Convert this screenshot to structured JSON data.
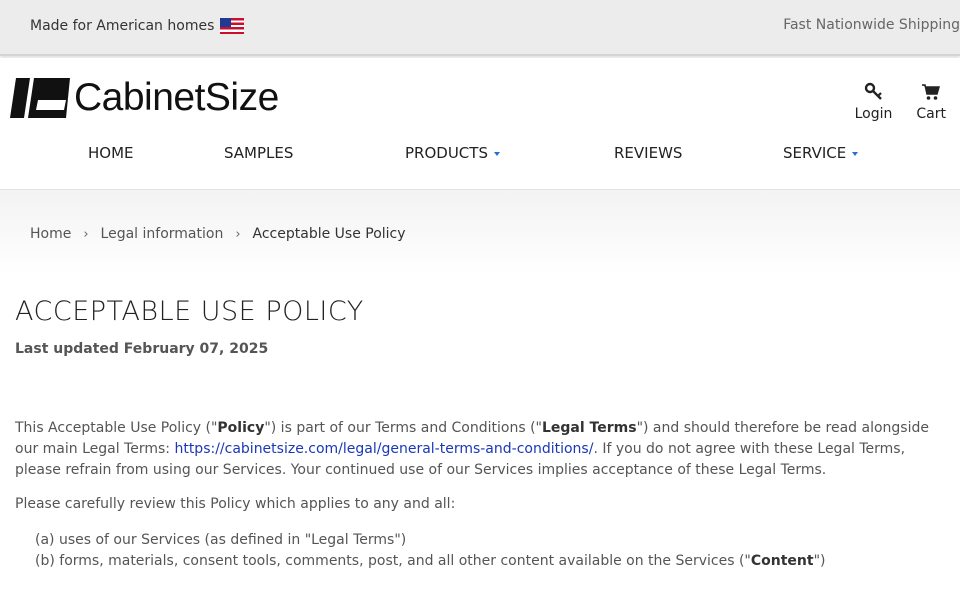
{
  "topbar": {
    "tagline": "Made for American homes",
    "shipping": "Fast Nationwide Shipping"
  },
  "brand": {
    "name": "CabinetSize"
  },
  "header": {
    "login_label": "Login",
    "cart_label": "Cart"
  },
  "nav": {
    "items": [
      {
        "label": "HOME"
      },
      {
        "label": "SAMPLES"
      },
      {
        "label": "PRODUCTS"
      },
      {
        "label": "REVIEWS"
      },
      {
        "label": "SERVICE"
      }
    ]
  },
  "breadcrumb": {
    "items": [
      "Home",
      "Legal information",
      "Acceptable Use Policy"
    ]
  },
  "content": {
    "title": "ACCEPTABLE USE POLICY",
    "updated": "Last updated February 07, 2025",
    "p1_a": "This Acceptable Use Policy (\"",
    "p1_b": "Policy",
    "p1_c": "\") is part of our Terms and Conditions (\"",
    "p1_d": "Legal Terms",
    "p1_e": "\") and should therefore be read alongside our main Legal Terms: ",
    "p1_link": "https://cabinetsize.com/legal/general-terms-and-conditions/",
    "p1_f": ". If you do not agree with these Legal Terms, please refrain from using our Services. Your continued use of our Services implies acceptance of these Legal Terms.",
    "p2": "Please carefully review this Policy which applies to any and all:",
    "list_a": "(a) uses of our Services (as defined in \"Legal Terms\")",
    "list_b1": "(b) forms, materials, consent tools, comments, post, and all other content available on the Services (\"",
    "list_b2": "Content",
    "list_b3": "\")"
  },
  "colors": {
    "link": "#1a37b8",
    "caret": "#2a6dd6",
    "topbar_bg": "#ececec"
  },
  "icons": [
    "us-flag-icon",
    "logo-mark-icon",
    "key-icon",
    "cart-icon",
    "caret-down-icon",
    "chevron-right-icon"
  ]
}
